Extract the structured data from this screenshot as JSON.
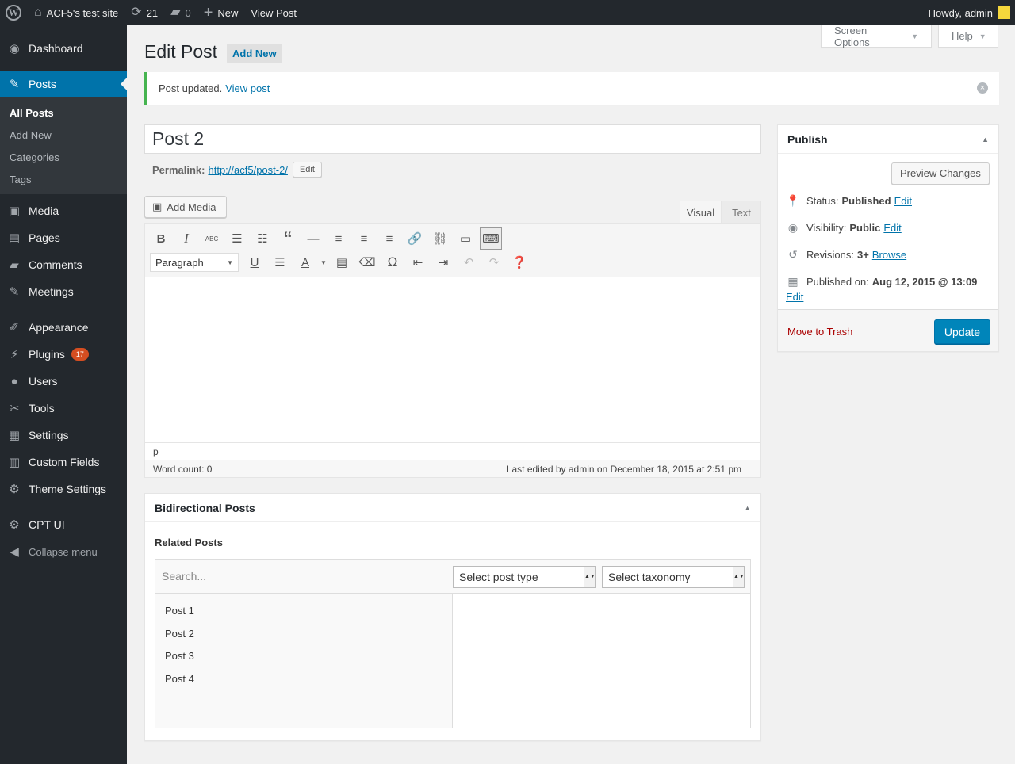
{
  "adminbar": {
    "site_name": "ACF5's test site",
    "updates_count": "21",
    "comments_count": "0",
    "new_label": "New",
    "view_post_label": "View Post",
    "howdy": "Howdy, admin"
  },
  "sidebar": {
    "items": [
      {
        "label": "Dashboard",
        "icon": "dashboard-icon"
      },
      {
        "label": "Posts",
        "icon": "pin-icon"
      },
      {
        "label": "Media",
        "icon": "media-icon"
      },
      {
        "label": "Pages",
        "icon": "pages-icon"
      },
      {
        "label": "Comments",
        "icon": "comment-icon"
      },
      {
        "label": "Meetings",
        "icon": "pin-icon"
      },
      {
        "label": "Appearance",
        "icon": "brush-icon"
      },
      {
        "label": "Plugins",
        "icon": "plugin-icon",
        "badge": "17"
      },
      {
        "label": "Users",
        "icon": "user-icon"
      },
      {
        "label": "Tools",
        "icon": "wrench-icon"
      },
      {
        "label": "Settings",
        "icon": "settings-icon"
      },
      {
        "label": "Custom Fields",
        "icon": "table-icon"
      },
      {
        "label": "Theme Settings",
        "icon": "gear-icon"
      },
      {
        "label": "CPT UI",
        "icon": "gear-icon"
      }
    ],
    "submenu": [
      "All Posts",
      "Add New",
      "Categories",
      "Tags"
    ],
    "collapse_label": "Collapse menu"
  },
  "header": {
    "screen_options": "Screen Options",
    "help": "Help",
    "title": "Edit Post",
    "add_new": "Add New"
  },
  "notice": {
    "text": "Post updated.",
    "link": "View post"
  },
  "post": {
    "title": "Post 2",
    "permalink_label": "Permalink:",
    "permalink_base": "http://acf5/",
    "permalink_slug": "post-2",
    "permalink_end": "/",
    "edit_label": "Edit"
  },
  "editor": {
    "add_media": "Add Media",
    "tab_visual": "Visual",
    "tab_text": "Text",
    "format_select": "Paragraph",
    "path": "p",
    "word_count": "Word count: 0",
    "last_edited": "Last edited by admin on December 18, 2015 at 2:51 pm"
  },
  "publish": {
    "title": "Publish",
    "preview": "Preview Changes",
    "status_label": "Status:",
    "status_value": "Published",
    "visibility_label": "Visibility:",
    "visibility_value": "Public",
    "revisions_label": "Revisions:",
    "revisions_value": "3+",
    "browse": "Browse",
    "published_on_label": "Published on:",
    "published_on_value": "Aug 12, 2015 @ 13:09",
    "edit": "Edit",
    "trash": "Move to Trash",
    "update": "Update"
  },
  "bidirectional": {
    "title": "Bidirectional Posts",
    "field_label": "Related Posts",
    "search_placeholder": "Search...",
    "post_type_select": "Select post type",
    "taxonomy_select": "Select taxonomy",
    "choices": [
      "Post 1",
      "Post 2",
      "Post 3",
      "Post 4"
    ]
  }
}
